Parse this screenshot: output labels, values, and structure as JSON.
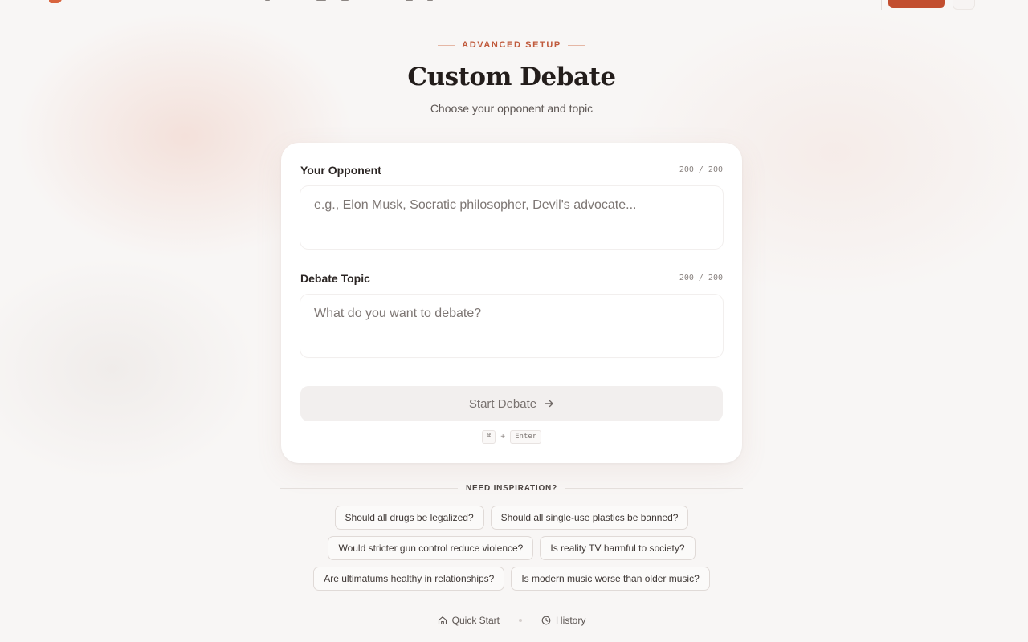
{
  "header": {
    "eyebrow": "ADVANCED SETUP",
    "title": "Custom Debate",
    "subtitle": "Choose your opponent and topic"
  },
  "form": {
    "opponent": {
      "label": "Your Opponent",
      "counter": "200 / 200",
      "value": "",
      "placeholder": "e.g., Elon Musk, Socratic philosopher, Devil's advocate..."
    },
    "topic": {
      "label": "Debate Topic",
      "counter": "200 / 200",
      "value": "",
      "placeholder": "What do you want to debate?"
    },
    "start_label": "Start Debate",
    "start_icon": "arrow-right-icon",
    "shortcut": {
      "key1": "⌘",
      "plus": "+",
      "key2": "Enter"
    }
  },
  "inspiration": {
    "heading": "NEED INSPIRATION?",
    "rows": [
      [
        "Should all drugs be legalized?",
        "Should all single-use plastics be banned?"
      ],
      [
        "Would stricter gun control reduce violence?",
        "Is reality TV harmful to society?"
      ],
      [
        "Are ultimatums healthy in relationships?",
        "Is modern music worse than older music?"
      ]
    ]
  },
  "footer": {
    "quick_start": "Quick Start",
    "history": "History",
    "quick_start_icon": "home-icon",
    "history_icon": "clock-icon"
  },
  "colors": {
    "accent": "#c24e2f",
    "background": "#f8f6f5",
    "card": "#ffffff"
  }
}
